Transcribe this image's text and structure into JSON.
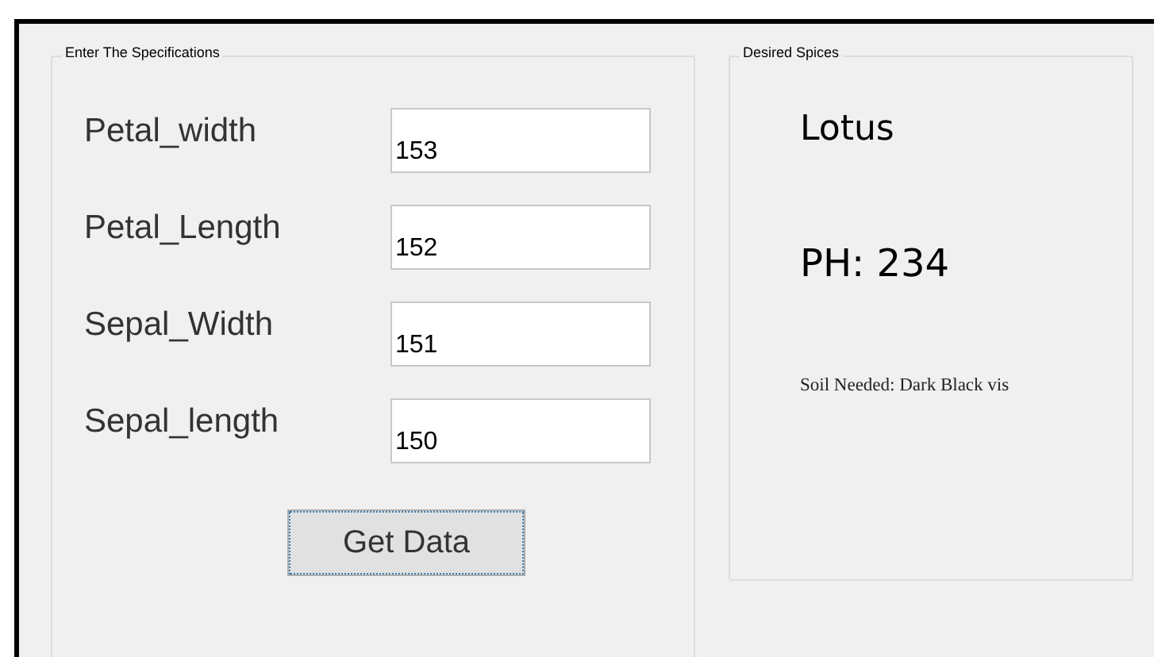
{
  "specifications": {
    "title": "Enter The Specifications",
    "fields": [
      {
        "label": "Petal_width",
        "value": "153"
      },
      {
        "label": "Petal_Length",
        "value": "152"
      },
      {
        "label": "Sepal_Width",
        "value": "151"
      },
      {
        "label": "Sepal_length",
        "value": "150"
      }
    ],
    "button": {
      "label": "Get Data",
      "focused": true
    }
  },
  "result": {
    "title": "Desired Spices",
    "name": "Lotus",
    "ph": "PH: 234",
    "soil": "Soil Needed: Dark Black vis"
  }
}
